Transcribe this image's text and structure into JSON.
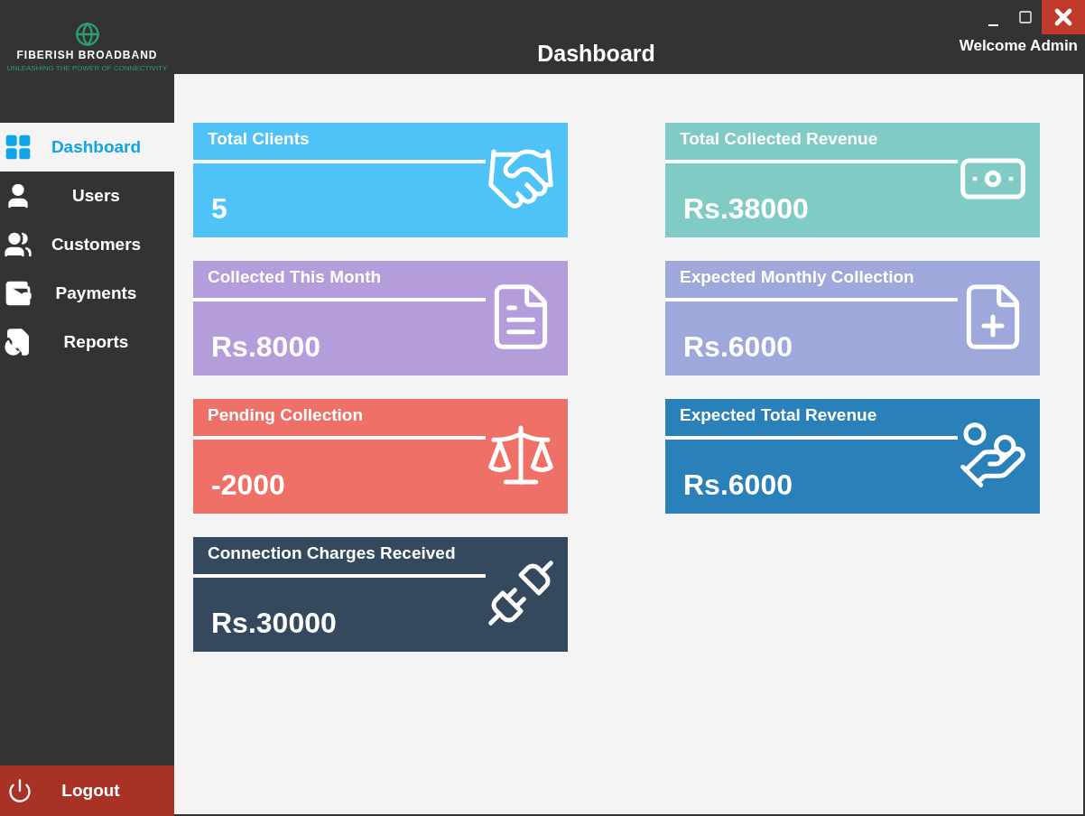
{
  "brand": {
    "name": "FIBERISH BROADBAND",
    "tagline": "UNLEASHING THE POWER OF CONNECTIVITY"
  },
  "window": {
    "title": "Dashboard",
    "welcome": "Welcome Admin"
  },
  "sidebar": {
    "items": [
      {
        "label": "Dashboard",
        "selected": true
      },
      {
        "label": "Users",
        "selected": false
      },
      {
        "label": "Customers",
        "selected": false
      },
      {
        "label": "Payments",
        "selected": false
      },
      {
        "label": "Reports",
        "selected": false
      }
    ],
    "logout": "Logout"
  },
  "cards": [
    {
      "title": "Total Clients",
      "value": "5",
      "color": "#4fc3f7"
    },
    {
      "title": "Total Collected Revenue",
      "value": "Rs.38000",
      "color": "#80cbc4"
    },
    {
      "title": "Collected This Month",
      "value": "Rs.8000",
      "color": "#b39ddb"
    },
    {
      "title": "Expected Monthly Collection",
      "value": "Rs.6000",
      "color": "#9fa8da"
    },
    {
      "title": "Pending Collection",
      "value": "-2000",
      "color": "#ef7067"
    },
    {
      "title": "Expected Total Revenue",
      "value": "Rs.6000",
      "color": "#2a80b9"
    },
    {
      "title": "Connection Charges Received",
      "value": "Rs.30000",
      "color": "#34495e"
    }
  ]
}
